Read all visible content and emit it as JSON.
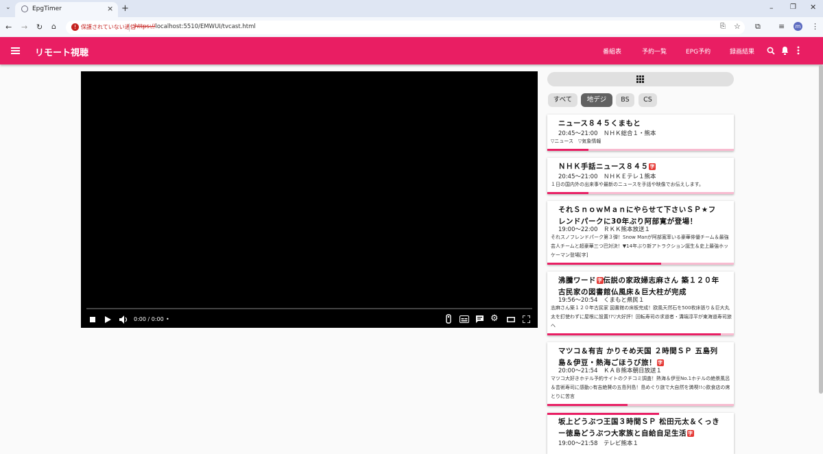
{
  "browser": {
    "tab_title": "EpgTimer",
    "security_label": "保護されていない通信",
    "url_scheme": "https://",
    "url_rest": "localhost:5510/EMWUI/tvcast.html",
    "profile_initial": "m"
  },
  "app": {
    "title": "リモート視聴",
    "nav": [
      "番組表",
      "予約一覧",
      "EPG予約",
      "録画結果"
    ],
    "accent_color": "#e91e63"
  },
  "player": {
    "time": "0:00 / 0:00",
    "dot": "•"
  },
  "channel_tabs": [
    {
      "label": "すべて",
      "active": false
    },
    {
      "label": "地デジ",
      "active": true
    },
    {
      "label": "BS",
      "active": false
    },
    {
      "label": "CS",
      "active": false
    }
  ],
  "programs": [
    {
      "title": "ニュース８４５くまもと",
      "badge": "",
      "time": "20:45～21:00　ＮＨＫ総合１・熊本",
      "desc": "▽ニュース　▽気象情報",
      "progress": 0.22
    },
    {
      "title": "ＮＨＫ手話ニュース８４５",
      "badge": "字",
      "time": "20:45～21:00　ＮＨＫＥテレ１熊本",
      "desc": "１日の国内外の出来事や最新のニュースを手話や映像でお伝えします。",
      "progress": 0.22
    },
    {
      "title": "それＳｎｏｗＭａｎにやらせて下さいＳＰ★フレンドパークに30年ぶり阿部寛が登場！",
      "badge": "",
      "time": "19:00～22:00　ＲＫＫ熊本放送１",
      "desc": "それスノフレンドパーク第３弾！Snow Manが阿部寛率いる豪華俳優チーム＆最強芸人チームと超豪華三つ巴対決！▼14年ぶり新アトラクション誕生＆史上最強ホッケーマン登場[字]",
      "progress": 0.61
    },
    {
      "title": "沸騰ワード",
      "badge": "字",
      "title_after": "伝説の家政婦志麻さん 築１２０年古民家の図書館仏風床＆巨大柱が完成",
      "time": "19:56～20:54　くまもと県民１",
      "desc": "志麻さん築１２０年古民家 図書館の床板完成！欧風天然石を500枚床張り＆巨大丸太を釘使わずに屋根に設置!?▽大好評！回転寿司の求道者・溝端淳平が東海道寿司旅へ",
      "progress": 0.93
    },
    {
      "title": "マツコ＆有吉 かりそめ天国 ２時間ＳＰ 五島列島＆伊豆・熱海ごほうび旅！",
      "badge": "字",
      "time": "20:00～21:54　ＫＡＢ熊本朝日放送１",
      "desc": "マツコ大好きホテル予約サイトのクチコミ調査！熱海＆伊豆No.1ホテルの絶景風呂＆芸術寿司に感動◇有吉絶賛の五島列島！島めぐり旅で大自然を満喫!!◇飲食店の席とりに苦言",
      "progress": 0.43
    },
    {
      "title": "坂上どうぶつ王国３時間ＳＰ 松田元太＆くっきー徳島どうぶつ大家族と自給自足生活",
      "badge": "字",
      "time": "19:00～21:58　テレビ熊本１",
      "desc": "",
      "progress": 0.6
    }
  ]
}
